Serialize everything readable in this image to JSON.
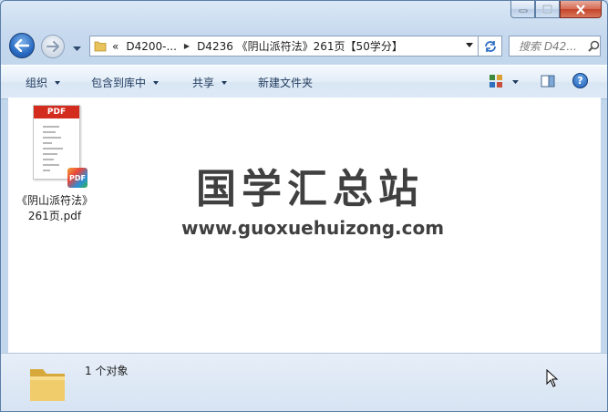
{
  "nav": {
    "breadcrumb": {
      "overflow": "«",
      "items": [
        "D4200-...",
        "D4236 《阴山派符法》261页【50学分】"
      ]
    },
    "search_placeholder": "搜索 D42..."
  },
  "toolbar": {
    "organize": "组织",
    "include_in_library": "包含到库中",
    "share": "共享",
    "new_folder": "新建文件夹"
  },
  "files": [
    {
      "name_line1": "《阴山派符法》",
      "name_line2": "261页.pdf",
      "icon_header": "PDF",
      "badge": "PDF"
    }
  ],
  "watermark": {
    "title": "国学汇总站",
    "url": "www.guoxuehuizong.com"
  },
  "details": {
    "count": "1 个对象"
  },
  "colors": {
    "accent": "#2a6bc2",
    "pdf_red": "#d32c1f",
    "window_frame": "#c6d9ee",
    "close_button": "#c44329"
  }
}
